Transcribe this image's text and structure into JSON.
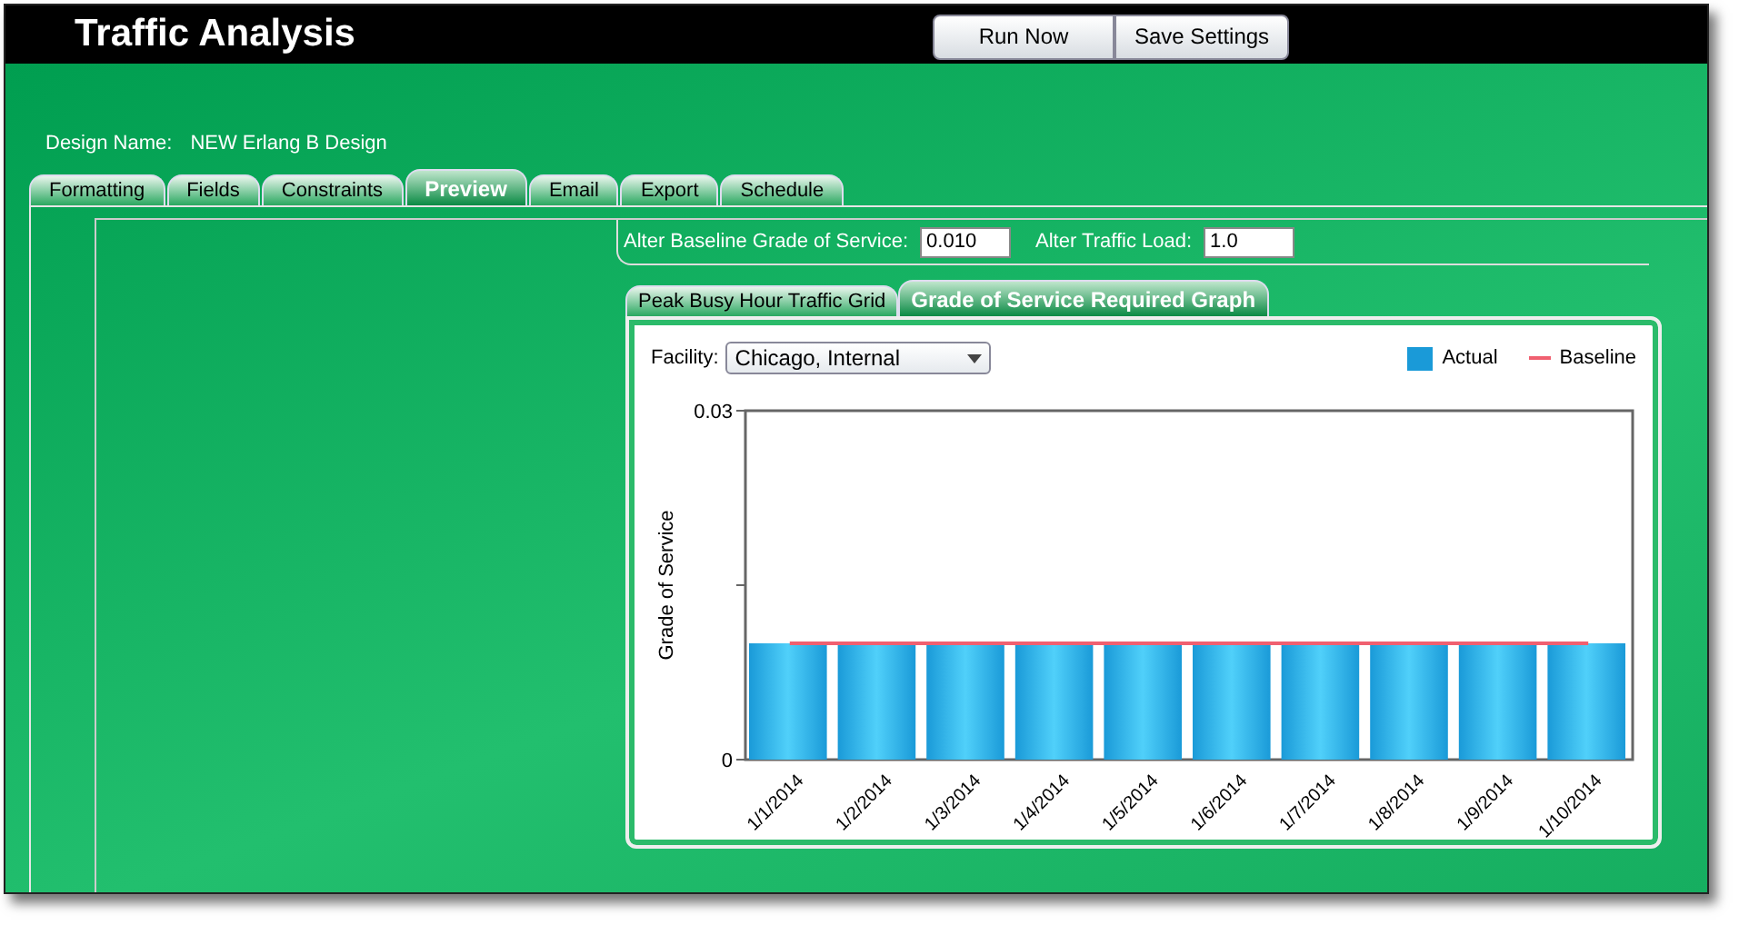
{
  "window": {
    "title": "Traffic Analysis"
  },
  "header_buttons": [
    "Run Now",
    "Save Settings"
  ],
  "design_name": {
    "label": "Design Name:",
    "value": "NEW Erlang B Design"
  },
  "tabs": [
    {
      "label": "Formatting",
      "selected": false
    },
    {
      "label": "Fields",
      "selected": false
    },
    {
      "label": "Constraints",
      "selected": false
    },
    {
      "label": "Preview",
      "selected": true
    },
    {
      "label": "Email",
      "selected": false
    },
    {
      "label": "Export",
      "selected": false
    },
    {
      "label": "Schedule",
      "selected": false
    }
  ],
  "options": [
    {
      "label": "Alter Baseline Grade of Service:",
      "value": "0.010"
    },
    {
      "label": "Alter Traffic Load:",
      "value": "1.0"
    }
  ],
  "sub_tabs": [
    {
      "label": "Peak Busy Hour Traffic Grid",
      "selected": false
    },
    {
      "label": "Grade of Service Required Graph",
      "selected": true
    }
  ],
  "facility": {
    "label": "Facility:",
    "value": "Chicago, Internal"
  },
  "chart_data": {
    "type": "bar",
    "ylabel": "Grade of Service",
    "categories": [
      "1/1/2014",
      "1/2/2014",
      "1/3/2014",
      "1/4/2014",
      "1/5/2014",
      "1/6/2014",
      "1/7/2014",
      "1/8/2014",
      "1/9/2014",
      "1/10/2014"
    ],
    "series": [
      {
        "name": "Actual",
        "color": "#1a9ad8",
        "values": [
          0.01,
          0.01,
          0.01,
          0.01,
          0.01,
          0.01,
          0.01,
          0.01,
          0.01,
          0.01
        ]
      },
      {
        "name": "Baseline",
        "type": "line",
        "color": "#f06070",
        "values": [
          0.01,
          0.01,
          0.01,
          0.01,
          0.01,
          0.01,
          0.01,
          0.01,
          0.01,
          0.01
        ]
      }
    ],
    "ylim": [
      0,
      0.03
    ],
    "yticks": [
      0,
      0.03
    ]
  }
}
